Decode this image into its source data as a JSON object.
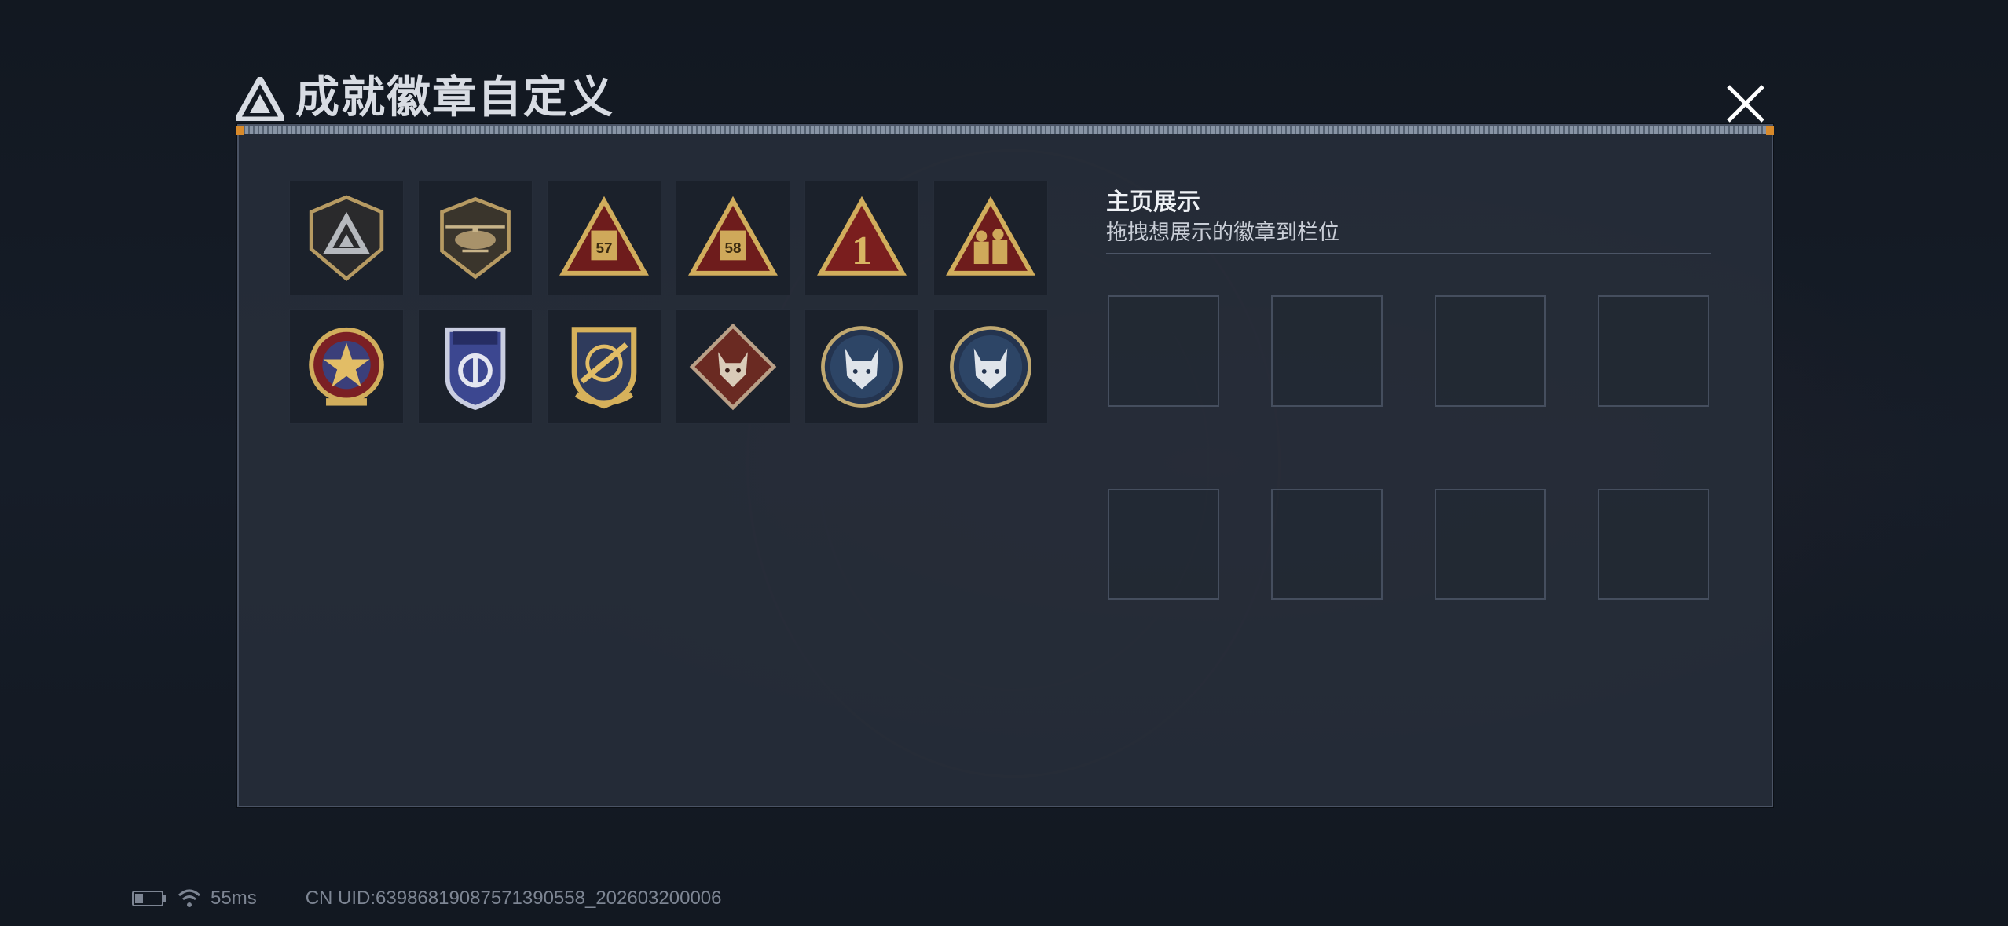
{
  "dialog": {
    "title": "成就徽章自定义",
    "close_icon": "close-icon",
    "logo_icon": "triangle-logo-icon"
  },
  "badges": [
    {
      "icon": "shield-triangle-badge-icon"
    },
    {
      "icon": "helicopter-badge-icon"
    },
    {
      "icon": "triangle-57-badge-icon",
      "label": "57"
    },
    {
      "icon": "triangle-58-badge-icon",
      "label": "58"
    },
    {
      "icon": "triangle-1-badge-icon",
      "label": "1"
    },
    {
      "icon": "triangle-soldiers-badge-icon"
    },
    {
      "icon": "star-round-badge-icon"
    },
    {
      "icon": "blue-shield-badge-icon"
    },
    {
      "icon": "crosshair-shield-badge-icon"
    },
    {
      "icon": "wolf-diamond-badge-icon"
    },
    {
      "icon": "lynx-round-badge-icon"
    },
    {
      "icon": "lynx-round-badge-icon-2"
    }
  ],
  "showcase": {
    "title": "主页展示",
    "subtitle": "拖拽想展示的徽章到栏位",
    "slot_count": 8
  },
  "status_bar": {
    "battery_icon": "battery-icon",
    "wifi_icon": "wifi-icon",
    "ping": "55ms",
    "uid": "CN UID:6398681908757139055​8_202603200006"
  },
  "colors": {
    "gold": "#c9a55a",
    "dark_red": "#6e1c1c",
    "panel": "#282e3a",
    "slot_border": "#454e5e"
  }
}
